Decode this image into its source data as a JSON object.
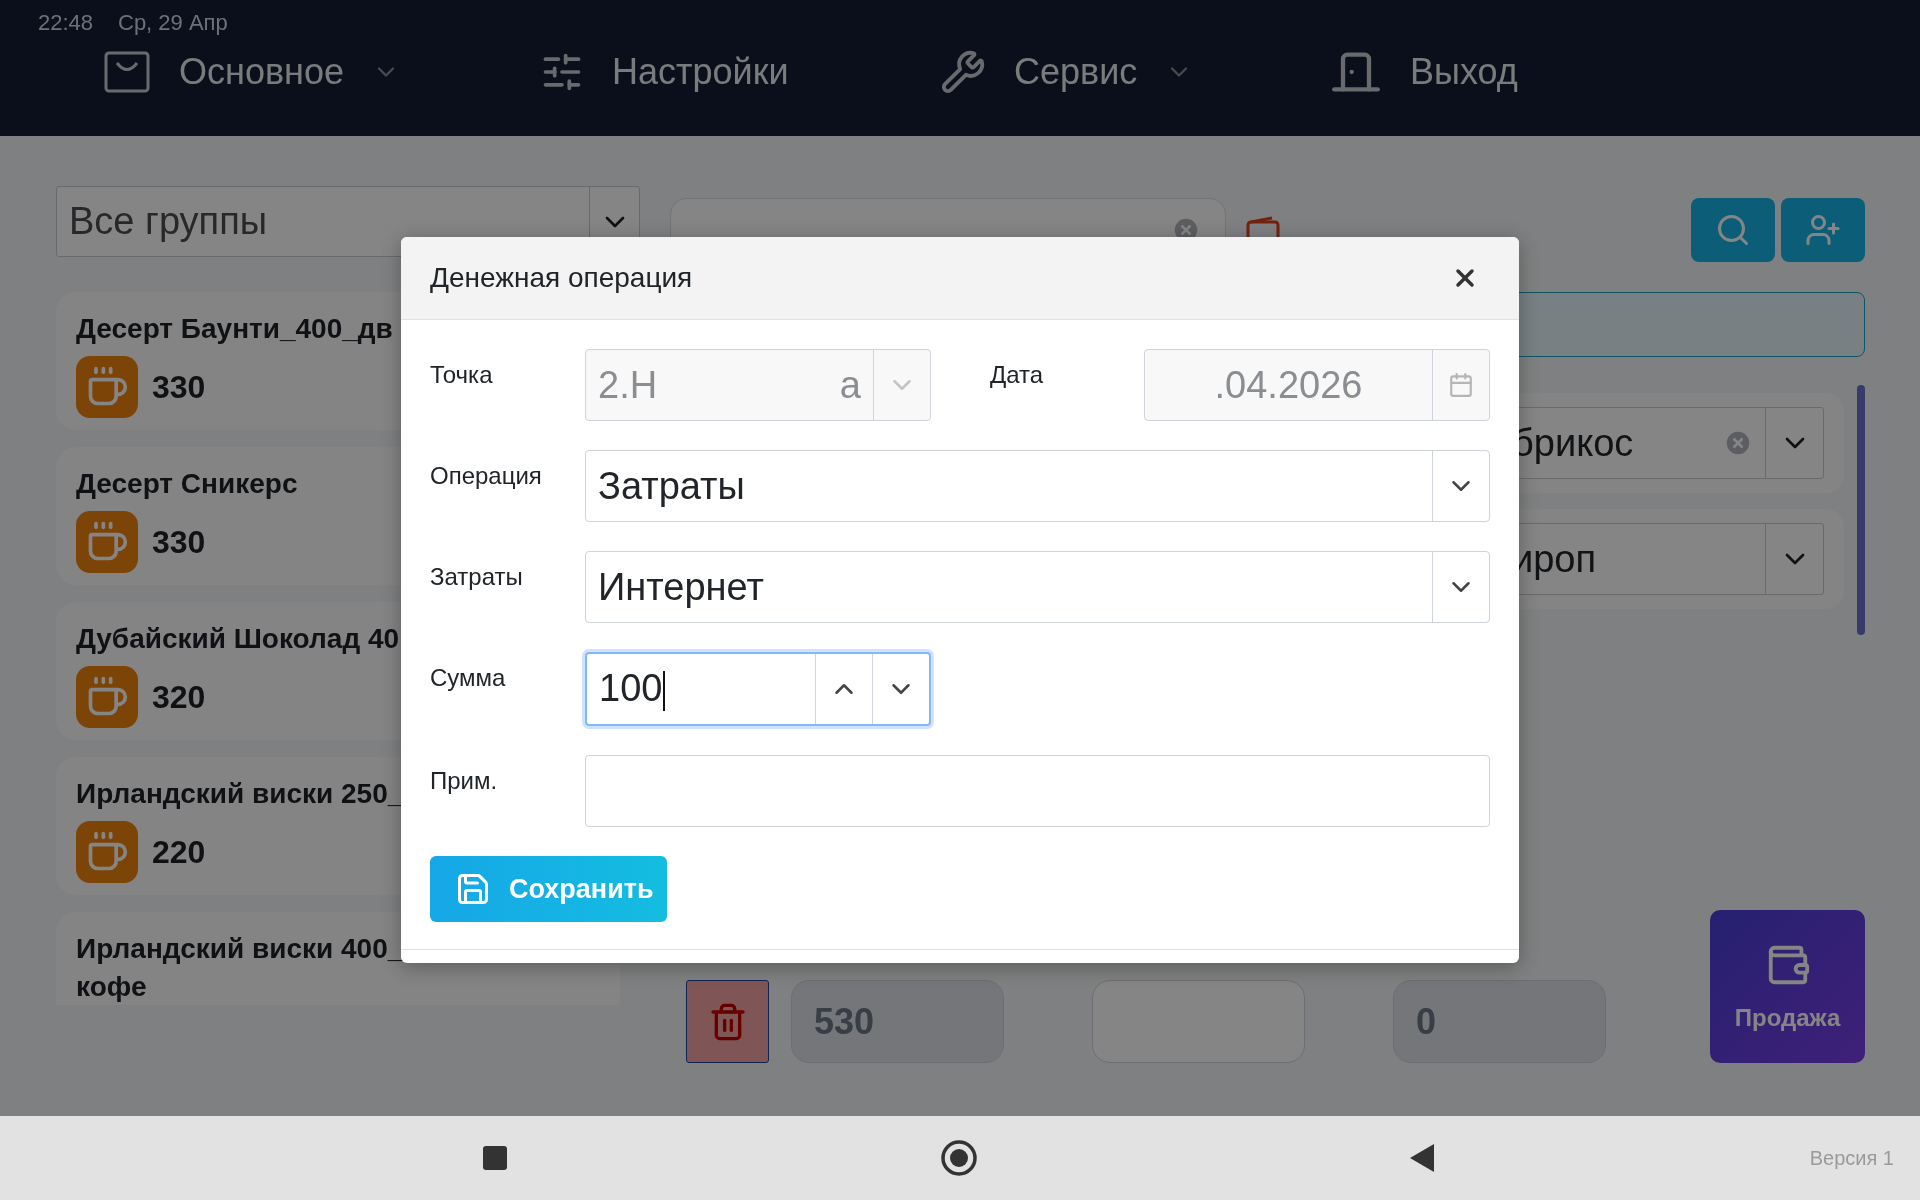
{
  "status_bar": {
    "time": "22:48",
    "date": "Ср, 29 Апр",
    "version": "Версия 1"
  },
  "nav": [
    {
      "kind": "main",
      "label": "Основное",
      "dropdown": true
    },
    {
      "kind": "settings",
      "label": "Настройки",
      "dropdown": false
    },
    {
      "kind": "service",
      "label": "Сервис",
      "dropdown": true
    },
    {
      "kind": "exit",
      "label": "Выход",
      "dropdown": false
    }
  ],
  "group_select": {
    "value": "Все группы"
  },
  "products": [
    {
      "name_lines": [
        "Десерт Баунти_400_дв"
      ],
      "price": "330"
    },
    {
      "name_lines": [
        "Десерт Сникерс"
      ],
      "price": "330"
    },
    {
      "name_lines": [
        "Дубайский Шоколад 40"
      ],
      "price": "320"
    },
    {
      "name_lines": [
        "Ирландский виски 250_"
      ],
      "price": "220"
    },
    {
      "name_lines": [
        "Ирландский виски 400_",
        "кофе"
      ]
    }
  ],
  "option_selects": [
    {
      "value": "брикос",
      "clearable": true
    },
    {
      "value": "ироп",
      "clearable": false
    }
  ],
  "totals": [
    {
      "value": "530",
      "disabled": false
    },
    {
      "disabled": true
    },
    {
      "value": "0",
      "disabled": false
    }
  ],
  "sale_button": {
    "label": "Продажа"
  },
  "modal": {
    "title": "Денежная операция",
    "rows": [
      {
        "fields": [
          {
            "kind": "select",
            "label": "Точка",
            "value_parts": [
              "2.Н",
              "а"
            ],
            "disabled": true,
            "wide": false
          },
          {
            "kind": "date",
            "label": "Дата",
            "value": ".04.2026",
            "disabled": true,
            "wide": false
          }
        ]
      },
      {
        "fields": [
          {
            "kind": "select",
            "label": "Операция",
            "value": "Затраты",
            "disabled": false,
            "wide": true
          }
        ]
      },
      {
        "fields": [
          {
            "kind": "select",
            "label": "Затраты",
            "value": "Интернет",
            "disabled": false,
            "wide": true
          }
        ]
      },
      {
        "fields": [
          {
            "kind": "number",
            "label": "Сумма",
            "value": "100",
            "focused": true,
            "wide": false
          }
        ]
      },
      {
        "fields": [
          {
            "kind": "text",
            "label": "Прим.",
            "wide": true
          }
        ]
      }
    ],
    "save_button": {
      "label": "Сохранить"
    }
  }
}
